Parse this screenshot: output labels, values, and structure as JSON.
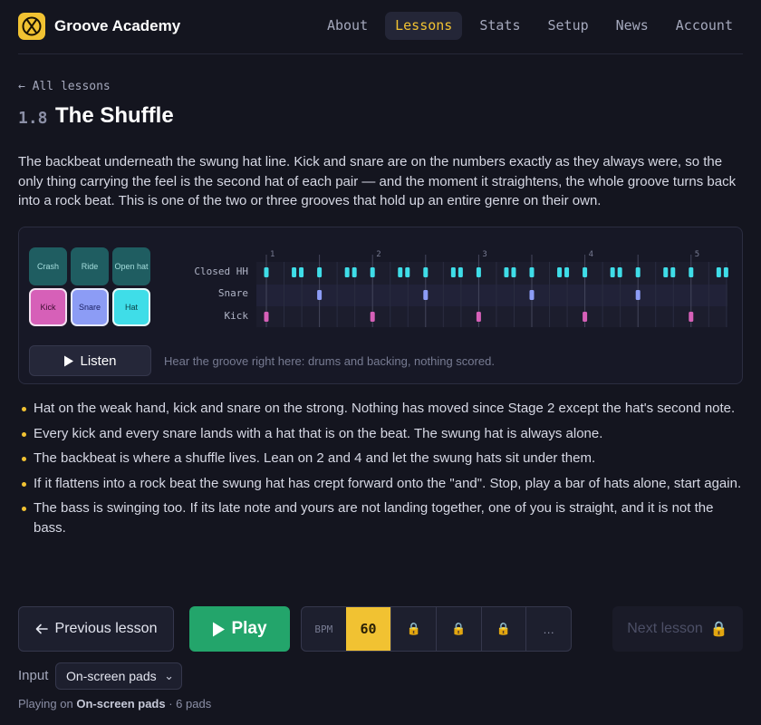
{
  "app": {
    "name": "Groove Academy",
    "nav": [
      {
        "label": "About",
        "active": false
      },
      {
        "label": "Lessons",
        "active": true
      },
      {
        "label": "Stats",
        "active": false
      },
      {
        "label": "Setup",
        "active": false
      },
      {
        "label": "News",
        "active": false
      },
      {
        "label": "Account",
        "active": false
      }
    ]
  },
  "lesson": {
    "back_label": "← All lessons",
    "number": "1.8",
    "title": "The Shuffle",
    "intro": "The backbeat underneath the swung hat line. Kick and snare are on the numbers exactly as they always were, so the only thing carrying the feel is the second hat of each pair — and the moment it straightens, the whole groove turns back into a rock beat. This is one of the two or three grooves that hold up an entire genre on their own."
  },
  "groove": {
    "pads": [
      {
        "label": "Crash",
        "lit": false
      },
      {
        "label": "Ride",
        "lit": false
      },
      {
        "label": "Open hat",
        "lit": false
      },
      {
        "label": "Kick",
        "lit": true
      },
      {
        "label": "Snare",
        "lit": true
      },
      {
        "label": "Hat",
        "lit": true
      }
    ],
    "listen_label": "Listen",
    "listen_hint": "Hear the groove right here: drums and backing, nothing scored.",
    "rows": [
      "Closed HH",
      "Snare",
      "Kick"
    ],
    "beat_numbers": [
      "1",
      "2",
      "3",
      "4",
      "5"
    ],
    "colors": {
      "hat": "#3fdde8",
      "snare": "#8c9cf5",
      "kick": "#d660b8"
    }
  },
  "tips": [
    "Hat on the weak hand, kick and snare on the strong. Nothing has moved since Stage 2 except the hat's second note.",
    "Every kick and every snare lands with a hat that is on the beat. The swung hat is always alone.",
    "The backbeat is where a shuffle lives. Lean on 2 and 4 and let the swung hats sit under them.",
    "If it flattens into a rock beat the swung hat has crept forward onto the \"and\". Stop, play a bar of hats alone, start again.",
    "The bass is swinging too. If its late note and yours are not landing together, one of you is straight, and it is not the bass."
  ],
  "controls": {
    "prev_label": "Previous lesson",
    "play_label": "Play",
    "bpm_label": "BPM",
    "bpm_value": "60",
    "bpm_more": "…",
    "next_label": "Next lesson",
    "input_label": "Input",
    "input_value": "On-screen pads",
    "status_prefix": "Playing on",
    "status_device": "On-screen pads",
    "status_suffix": "· 6 pads"
  },
  "theme": {
    "accent": "#f1c232",
    "play": "#23a56b"
  }
}
